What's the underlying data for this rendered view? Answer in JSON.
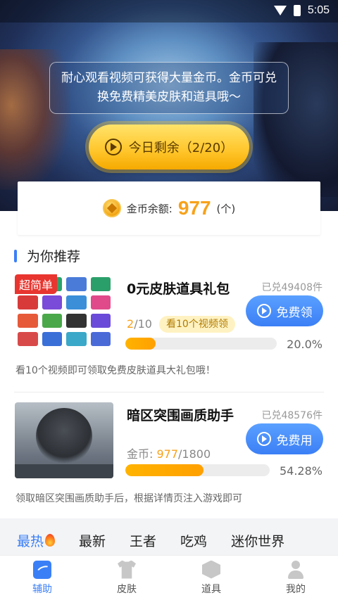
{
  "status_bar": {
    "time": "5:05"
  },
  "hero": {
    "notice": "耐心观看视频可获得大量金币。金币可兑换免费精美皮肤和道具哦～",
    "today_button": "今日剩余（2/20）"
  },
  "balance": {
    "label": "金币余额:",
    "value": "977",
    "unit": "(个)"
  },
  "section": {
    "title": "为你推荐"
  },
  "items": [
    {
      "tag": "超简单",
      "title": "0元皮肤道具礼包",
      "redeemed": "已兑49408件",
      "button": "免费领",
      "progress_current": "2",
      "progress_total": "/10",
      "watch_tag": "看10个视频领",
      "progress_fraction": 0.2,
      "percent": "20.0%",
      "desc": "看10个视频即可领取免费皮肤道具大礼包哦！"
    },
    {
      "title": "暗区突围画质助手",
      "redeemed": "已兑48576件",
      "button": "免费用",
      "coin_label": "金币: ",
      "coin_current": "977",
      "coin_total": "/1800",
      "progress_fraction": 0.5428,
      "percent": "54.28%",
      "desc": "领取暗区突围画质助手后，根据详情页注入游戏即可"
    }
  ],
  "categories": [
    "最热",
    "最新",
    "王者",
    "吃鸡",
    "迷你世界"
  ],
  "bottom_nav": [
    {
      "label": "辅助",
      "icon": "assist-icon"
    },
    {
      "label": "皮肤",
      "icon": "shirt-icon"
    },
    {
      "label": "道具",
      "icon": "box-icon"
    },
    {
      "label": "我的",
      "icon": "user-icon"
    }
  ],
  "colors": {
    "accent": "#3b7ff6",
    "gold": "#f7a21b",
    "tag_red": "#e8352f"
  }
}
